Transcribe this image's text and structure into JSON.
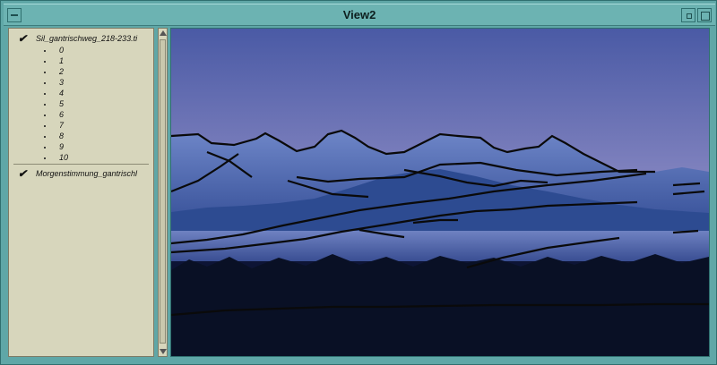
{
  "window": {
    "title": "View2"
  },
  "layers": [
    {
      "label": "Sil_gantrischweg_218-233.ti",
      "checked": true,
      "classes": [
        "0",
        "1",
        "2",
        "3",
        "4",
        "5",
        "6",
        "7",
        "8",
        "9",
        "10"
      ]
    },
    {
      "label": "Morgenstimmung_gantrischl",
      "checked": true
    }
  ],
  "icons": {
    "check": "check-icon",
    "menu": "window-menu-icon",
    "minimize": "minimize-icon",
    "maximize": "maximize-icon"
  },
  "colors": {
    "window": "#5fa7a7",
    "panel": "#d7d6bc",
    "sky": "#c7a7cf",
    "mountains": "#243f86",
    "trace": "#111111"
  }
}
